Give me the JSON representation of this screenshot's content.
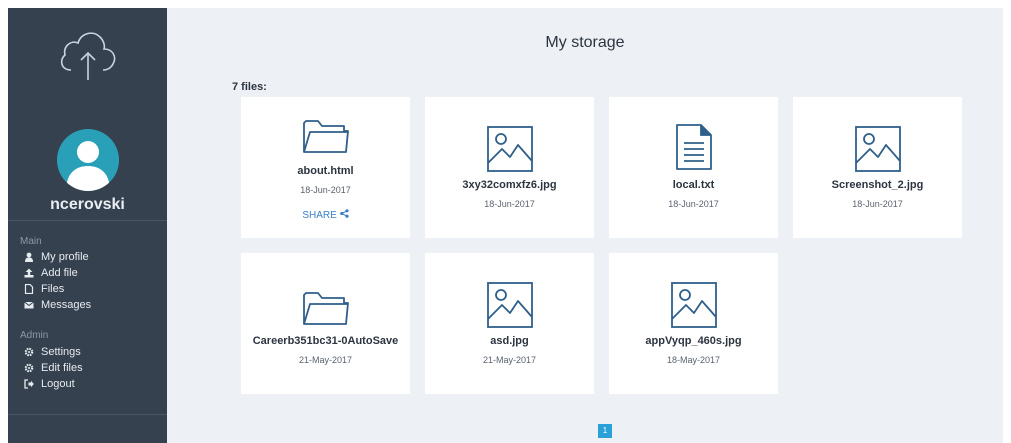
{
  "sidebar": {
    "username": "ncerovski",
    "main_label": "Main",
    "main_items": [
      {
        "label": "My profile",
        "icon": "user-icon"
      },
      {
        "label": "Add file",
        "icon": "upload-icon"
      },
      {
        "label": "Files",
        "icon": "file-icon"
      },
      {
        "label": "Messages",
        "icon": "envelope-icon"
      }
    ],
    "admin_label": "Admin",
    "admin_items": [
      {
        "label": "Settings",
        "icon": "gear-icon"
      },
      {
        "label": "Edit files",
        "icon": "gear-icon"
      },
      {
        "label": "Logout",
        "icon": "logout-icon"
      }
    ]
  },
  "main": {
    "title": "My storage",
    "file_count": "7 files:",
    "files": [
      {
        "name": "about.html",
        "date": "18-Jun-2017",
        "type": "folder",
        "share": "SHARE"
      },
      {
        "name": "3xy32comxfz6.jpg",
        "date": "18-Jun-2017",
        "type": "image"
      },
      {
        "name": "local.txt",
        "date": "18-Jun-2017",
        "type": "document"
      },
      {
        "name": "Screenshot_2.jpg",
        "date": "18-Jun-2017",
        "type": "image"
      },
      {
        "name": "Careerb351bc31-0AutoSave",
        "date": "21-May-2017",
        "type": "folder"
      },
      {
        "name": "asd.jpg",
        "date": "21-May-2017",
        "type": "image"
      },
      {
        "name": "appVyqp_460s.jpg",
        "date": "18-May-2017",
        "type": "image"
      }
    ],
    "pagination": {
      "current": "1"
    }
  },
  "colors": {
    "sidebar": "#36414f",
    "accent": "#2aa0d8",
    "avatar": "#2aa0b8",
    "link": "#3b7fc4",
    "icon": "#2f5f8a"
  }
}
